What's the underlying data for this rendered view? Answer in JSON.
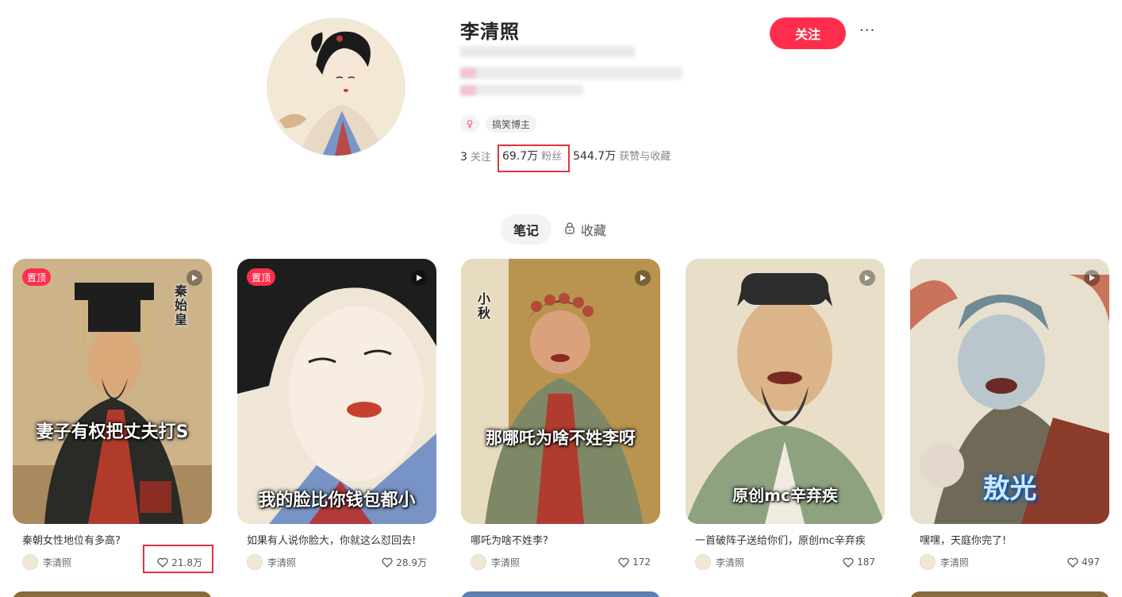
{
  "profile": {
    "name": "李清照",
    "tag": "搞笑博主",
    "follow_label": "关注",
    "more_label": "···",
    "stats": {
      "following_num": "3",
      "following_label": "关注",
      "fans_num": "69.7万",
      "fans_label": "粉丝",
      "likes_num": "544.7万",
      "likes_label": "获赞与收藏"
    }
  },
  "tabs": {
    "notes": "笔记",
    "collect": "收藏"
  },
  "notes": [
    {
      "cover_text": "妻子有权把丈夫打S",
      "side_text": "秦始皇",
      "pinned_label": "置顶",
      "title": "秦朝女性地位有多高?",
      "author": "李清照",
      "likes": "21.8万"
    },
    {
      "cover_text": "我的脸比你钱包都小",
      "pinned_label": "置顶",
      "title": "如果有人说你脸大，你就这么怼回去!",
      "author": "李清照",
      "likes": "28.9万"
    },
    {
      "cover_text": "那哪吒为啥不姓李呀",
      "side_text": "小秋",
      "title": "哪吒为啥不姓李?",
      "author": "李清照",
      "likes": "172"
    },
    {
      "cover_text": "原创mc辛弃疾",
      "title": "一首破阵子送给你们，原创mc辛弃疾",
      "author": "李清照",
      "likes": "187"
    },
    {
      "cover_text": "敖光",
      "title": "嘿嘿，天庭你完了!",
      "author": "李清照",
      "likes": "497"
    }
  ],
  "colors": {
    "accent": "#ff2e4d",
    "highlight_box": "#e0343a"
  }
}
